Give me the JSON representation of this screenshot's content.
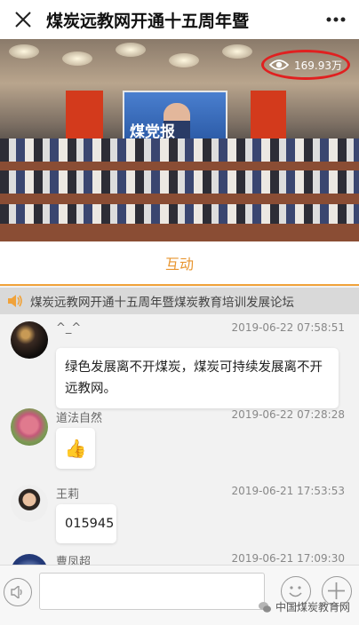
{
  "header": {
    "title": "煤炭远教网开通十五周年暨",
    "close_icon": "close-icon",
    "more_icon": "more-icon"
  },
  "video": {
    "view_count": "169.93万",
    "screen_text": "煤党报"
  },
  "tabs": {
    "active": "互动"
  },
  "notice": {
    "text": "煤炭远教网开通十五周年暨煤炭教育培训发展论坛"
  },
  "messages": [
    {
      "name": "^_^",
      "time": "2019-06-22 07:58:51",
      "text": "绿色发展离不开煤炭，煤炭可持续发展离不开远教网。"
    },
    {
      "name": "道法自然",
      "time": "2019-06-22 07:28:28",
      "text": "👍"
    },
    {
      "name": "王莉",
      "time": "2019-06-21 17:53:53",
      "text": "015945"
    },
    {
      "name": "曹凤超",
      "time": "2019-06-21 17:09:30",
      "text": ""
    }
  ],
  "bottom": {
    "input_placeholder": "",
    "watermark": "中国煤炭教育网"
  },
  "colors": {
    "accent": "#e8952f",
    "badge_red": "#e02020"
  }
}
